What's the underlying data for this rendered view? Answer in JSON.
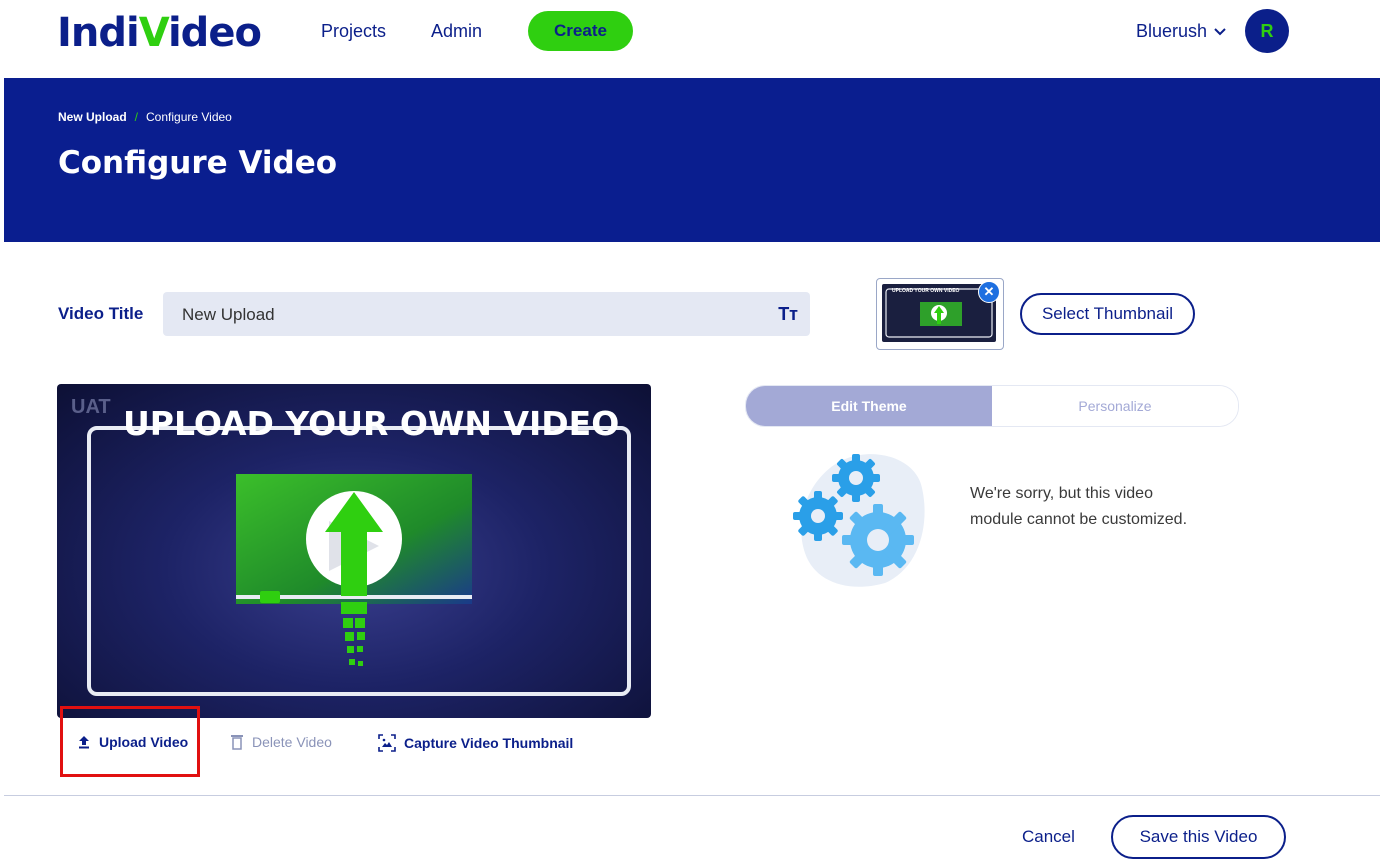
{
  "header": {
    "logo_text_a": "Indi",
    "logo_text_v": "V",
    "logo_text_b": "ideo",
    "nav": [
      "Projects",
      "Admin"
    ],
    "create_label": "Create",
    "account_name": "Bluerush",
    "avatar_initial": "R"
  },
  "banner": {
    "breadcrumb": [
      "New Upload",
      "Configure Video"
    ],
    "breadcrumb_separator": "/",
    "title": "Configure Video"
  },
  "form": {
    "video_title_label": "Video Title",
    "video_title_value": "New Upload",
    "text_format_icon": "Tт",
    "thumbnail_text": "UPLOAD YOUR OWN VIDEO",
    "select_thumbnail_label": "Select Thumbnail"
  },
  "video": {
    "watermark": "UAT",
    "heading": "UPLOAD YOUR OWN VIDEO"
  },
  "actions": {
    "upload": "Upload Video",
    "delete": "Delete Video",
    "capture": "Capture Video Thumbnail"
  },
  "tabs": [
    {
      "label": "Edit Theme",
      "active": true
    },
    {
      "label": "Personalize",
      "active": false
    }
  ],
  "customize_message": "We're sorry, but this video module cannot be customized.",
  "footer": {
    "cancel": "Cancel",
    "save": "Save this Video"
  },
  "colors": {
    "brand_blue": "#0b1f8a",
    "brand_green": "#2fcf10",
    "highlight_red": "#e11010"
  }
}
